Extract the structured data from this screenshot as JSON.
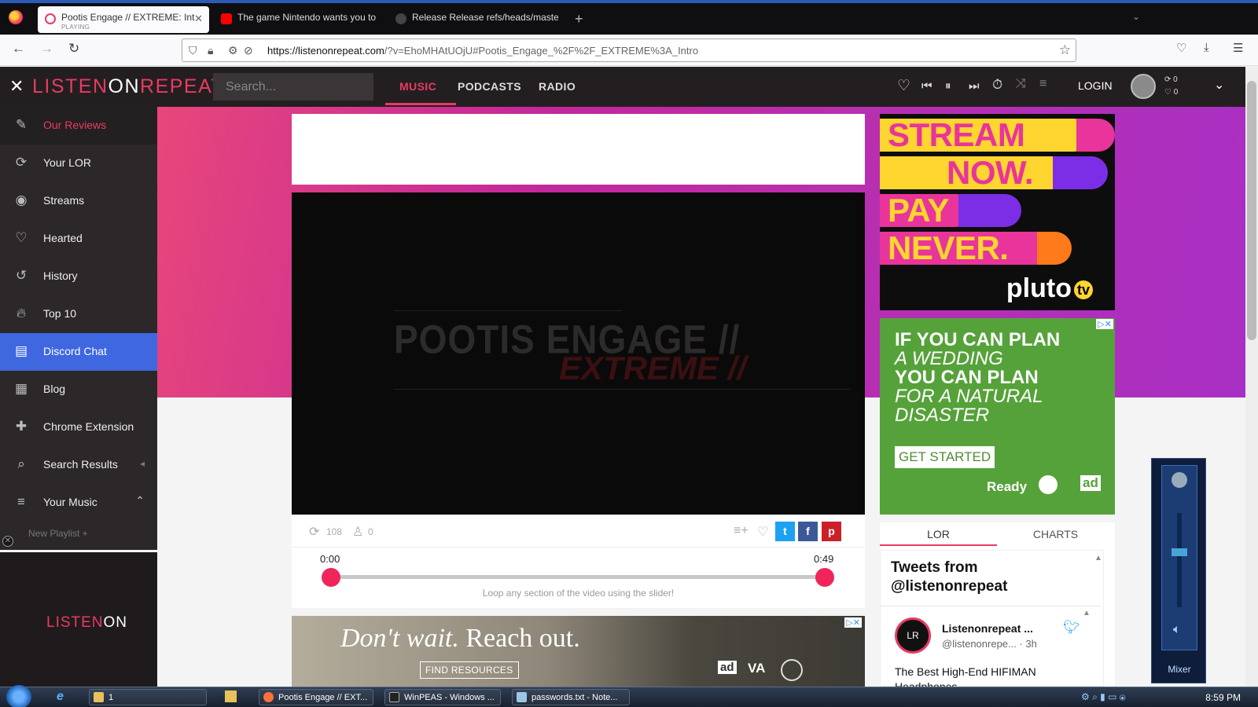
{
  "browser": {
    "tabs": [
      {
        "title": "Pootis Engage // EXTREME: Int",
        "sub": "PLAYING",
        "active": true
      },
      {
        "title": "The game Nintendo wants you to"
      },
      {
        "title": "Release Release refs/heads/maste"
      }
    ],
    "url_host": "https://listenonrepeat.com",
    "url_rest": "/?v=EhoMHAtUOjU#Pootis_Engage_%2F%2F_EXTREME%3A_Intro"
  },
  "header": {
    "logo_left": "LISTEN",
    "logo_on": "ON",
    "logo_right": "REPEAT",
    "search_placeholder": "Search...",
    "menu": [
      "MUSIC",
      "PODCASTS",
      "RADIO"
    ],
    "login": "LOGIN",
    "stats": [
      "0",
      "0"
    ]
  },
  "sidebar": {
    "items": [
      {
        "label": "Our Reviews",
        "icon": "reviews-icon"
      },
      {
        "label": "Your LOR",
        "icon": "loop-icon"
      },
      {
        "label": "Streams",
        "icon": "streams-icon"
      },
      {
        "label": "Hearted",
        "icon": "heart-icon"
      },
      {
        "label": "History",
        "icon": "history-icon"
      },
      {
        "label": "Top 10",
        "icon": "fire-icon"
      },
      {
        "label": "Discord Chat",
        "icon": "chat-icon"
      },
      {
        "label": "Blog",
        "icon": "blog-icon"
      },
      {
        "label": "Chrome Extension",
        "icon": "puzzle-icon"
      },
      {
        "label": "Search Results",
        "icon": "search-icon"
      },
      {
        "label": "Your Music",
        "icon": "music-list-icon"
      }
    ],
    "new_playlist": "New Playlist +",
    "mini_logo_left": "LISTEN",
    "mini_logo_on": "ON"
  },
  "video": {
    "title_line1": "POOTIS ENGAGE //",
    "title_line2": "EXTREME //",
    "repeat_count": "108",
    "listeners": "0",
    "start_time": "0:00",
    "end_time": "0:49",
    "hint": "Loop any section of the video using the slider!"
  },
  "ads": {
    "bottom_headline_italic": "Don't wait.",
    "bottom_headline": "Reach out.",
    "bottom_button": "FIND RESOURCES",
    "pluto_lines": [
      "STREAM",
      "NOW.",
      "PAY",
      "NEVER."
    ],
    "pluto_logo": "pluto",
    "green_lines": [
      "IF YOU CAN PLAN",
      "A WEDDING",
      "YOU CAN PLAN",
      "FOR A NATURAL",
      "DISASTER"
    ],
    "green_button": "GET STARTED",
    "green_logo": "Ready"
  },
  "panel": {
    "tabs": [
      "LOR",
      "CHARTS"
    ],
    "tweets_title": "Tweets from @listenonrepeat",
    "tweet_name": "Listenonrepeat ...",
    "tweet_handle": "@listenonrepe... · 3h",
    "tweet_text": "The Best High-End HIFIMAN Headphones"
  },
  "mixer": {
    "label": "Mixer"
  },
  "taskbar": {
    "items": [
      "1",
      "Pootis Engage // EXT...",
      "WinPEAS - Windows ...",
      "passwords.txt - Note..."
    ],
    "clock": "8:59 PM"
  }
}
